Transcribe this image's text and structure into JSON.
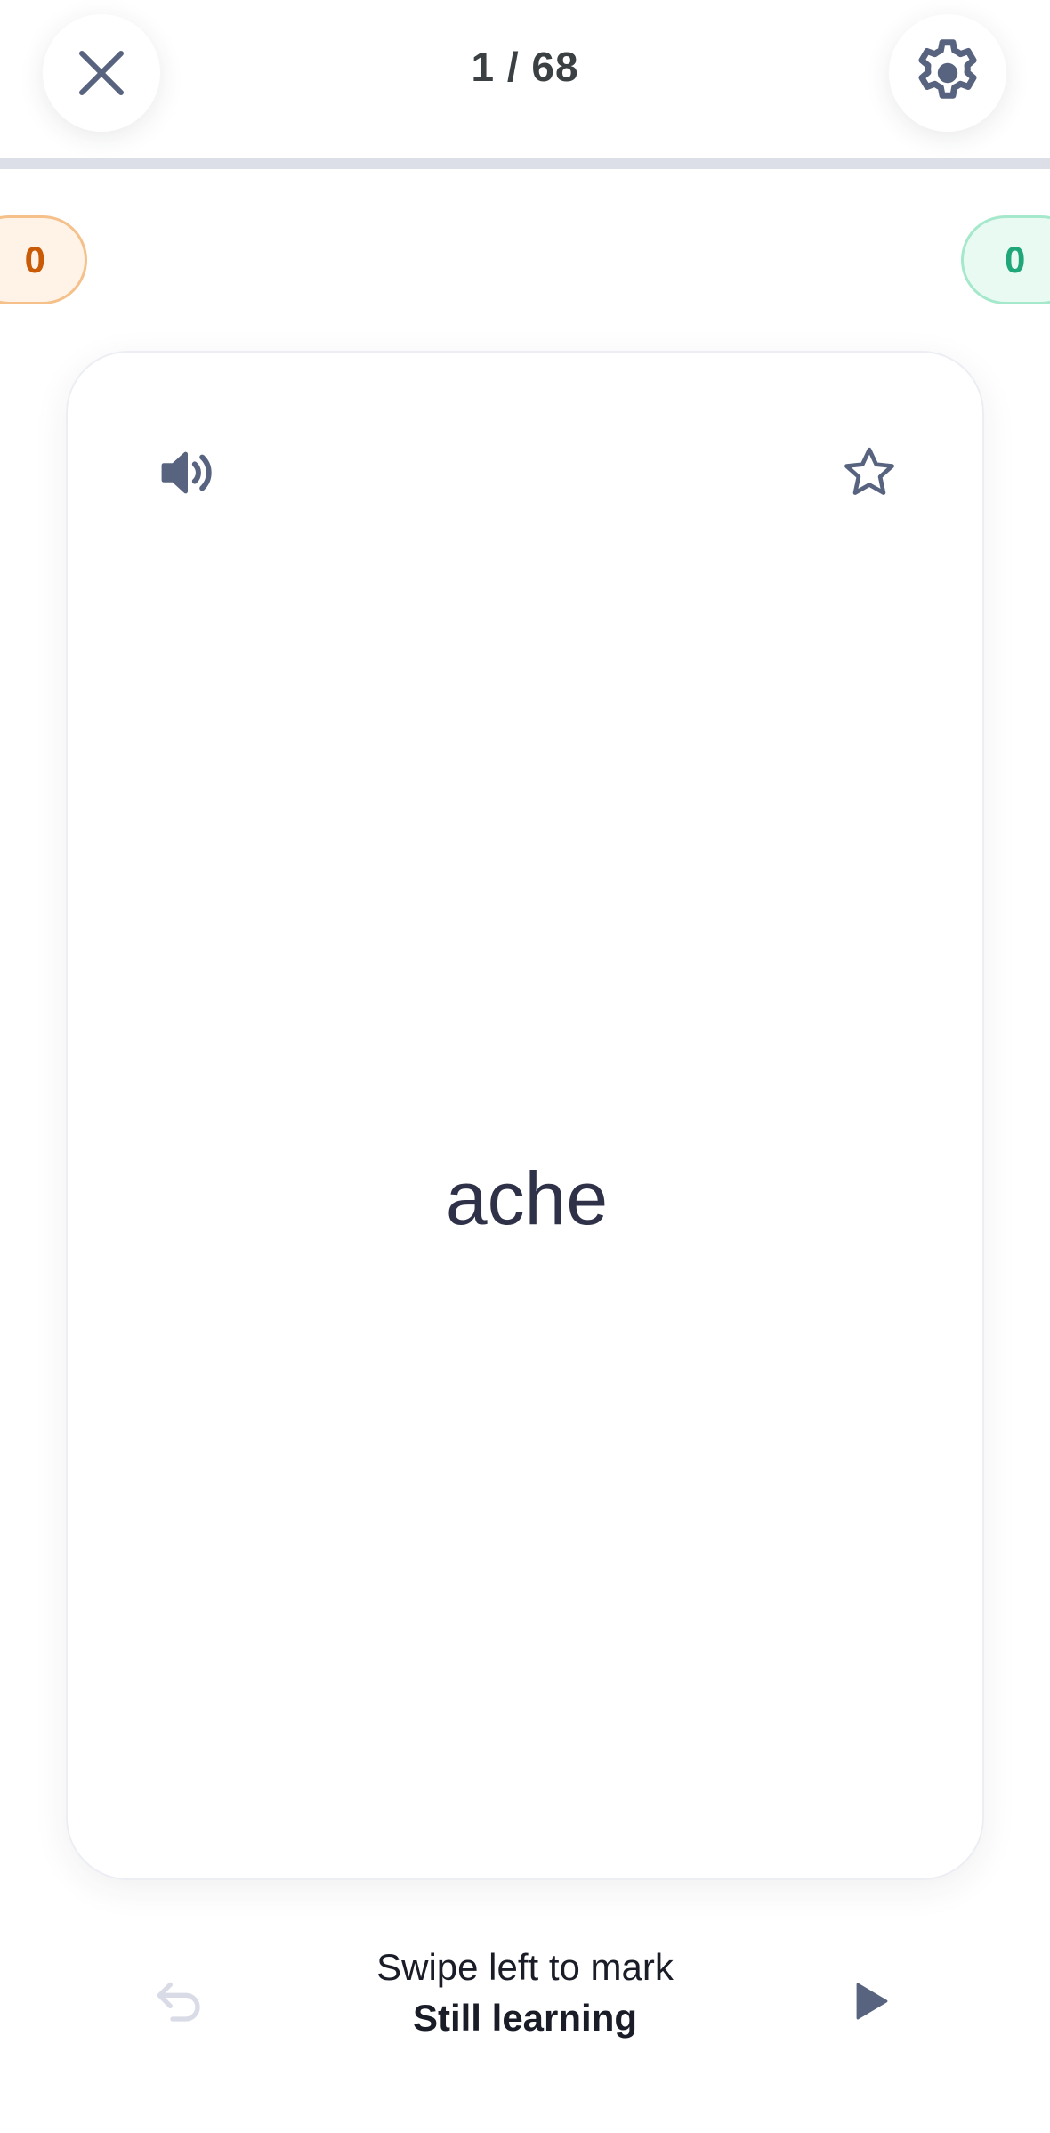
{
  "header": {
    "counter": "1 / 68",
    "close_icon": "close-icon",
    "settings_icon": "gear-icon",
    "progress_fraction": 0.0
  },
  "scores": {
    "still_learning": "0",
    "know": "0",
    "still_learning_color": "#c95a06",
    "know_color": "#1fa77a"
  },
  "card": {
    "term": "ache",
    "audio_icon": "speaker-icon",
    "star_icon": "star-icon"
  },
  "footer": {
    "hint_line1": "Swipe left to mark",
    "hint_line2": "Still learning",
    "undo_icon": "undo-icon",
    "play_icon": "play-icon"
  },
  "colors": {
    "icon": "#586380",
    "text": "#2e3147",
    "undo_disabled": "#d9dce6"
  }
}
